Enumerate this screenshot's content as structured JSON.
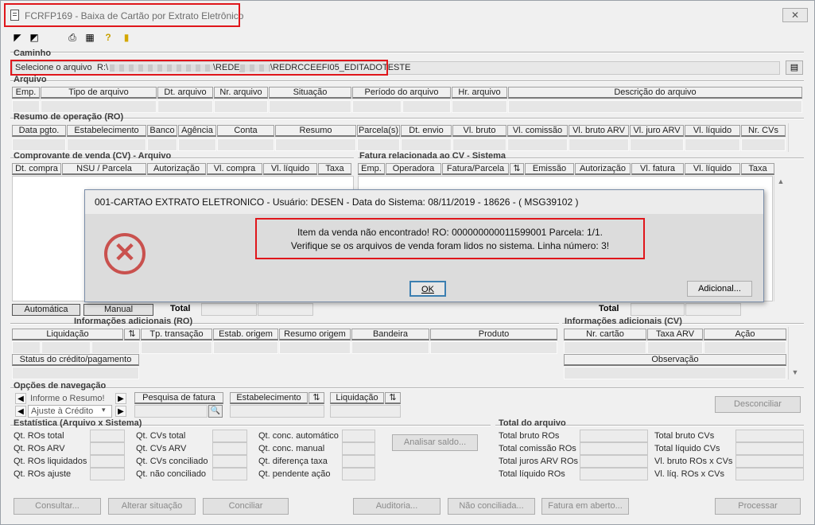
{
  "window": {
    "title": "FCRFP169 - Baixa de Cartão por Extrato Eletrônico",
    "close_label": "✕"
  },
  "toolbar": {
    "icons": [
      "first-icon",
      "exit-icon",
      "print-icon",
      "calculator-icon",
      "help-icon",
      "door-icon"
    ]
  },
  "caminho": {
    "section": "Caminho",
    "label": "Selecione o arquivo",
    "path_start": "R:\\",
    "path_mid": "\\REDE_",
    "path_end": "\\REDRCCEEFI05_EDITADOTESTE"
  },
  "arquivo": {
    "section": "Arquivo",
    "columns": [
      "Emp.",
      "Tipo de arquivo",
      "Dt. arquivo",
      "Nr. arquivo",
      "Situação",
      "Período do arquivo",
      "Hr. arquivo",
      "Descrição do arquivo"
    ]
  },
  "resumo": {
    "section": "Resumo de operação (RO)",
    "columns": [
      "Data pgto.",
      "Estabelecimento",
      "Banco",
      "Agência",
      "Conta",
      "Resumo",
      "Parcela(s)",
      "Dt. envio",
      "Vl. bruto",
      "Vl. comissão",
      "Vl. bruto ARV",
      "Vl. juro ARV",
      "Vl. líquido",
      "Nr. CVs"
    ]
  },
  "comprovante": {
    "section": "Comprovante de venda (CV) - Arquivo",
    "columns": [
      "Dt. compra",
      "NSU / Parcela",
      "Autorização",
      "Vl. compra",
      "Vl. líquido",
      "Taxa"
    ],
    "btn_automatica": "Automática",
    "btn_manual": "Manual",
    "total_label": "Total"
  },
  "fatura": {
    "section": "Fatura relacionada ao CV - Sistema",
    "columns": [
      "Emp.",
      "Operadora",
      "Fatura/Parcela",
      "",
      "Emissão",
      "Autorização",
      "Vl. fatura",
      "Vl. líquido",
      "Taxa"
    ],
    "total_label": "Total"
  },
  "dialog": {
    "title": "001-CARTAO EXTRATO ELETRONICO - Usuário: DESEN - Data do Sistema: 08/11/2019 - 18626 - ( MSG39102 )",
    "line1": "Item da venda não encontrado! RO: 000000000011599001 Parcela: 1/1.",
    "line2": "Verifique se os arquivos de venda foram lidos no sistema. Linha número: 3!",
    "ok": "OK",
    "additional": "Adicional..."
  },
  "info_ro": {
    "section": "Informações adicionais (RO)",
    "columns": [
      "Liquidação",
      "",
      "Tp. transação",
      "Estab. origem",
      "Resumo origem",
      "Bandeira",
      "Produto"
    ],
    "status_label": "Status do crédito/pagamento"
  },
  "info_cv": {
    "section": "Informações adicionais (CV)",
    "columns": [
      "Nr. cartão",
      "Taxa ARV",
      "Ação"
    ],
    "obs": "Observação"
  },
  "nav": {
    "section": "Opções de navegação",
    "informe": "Informe o Resumo!",
    "ajuste": "Ajuste à Crédito",
    "pesquisa": "Pesquisa de fatura",
    "estab": "Estabelecimento",
    "liquid": "Liquidação",
    "desconciliar": "Desconciliar"
  },
  "estat": {
    "section": "Estatística (Arquivo x Sistema)",
    "col1": [
      "Qt. ROs total",
      "Qt. ROs ARV",
      "Qt. ROs liquidados",
      "Qt. ROs ajuste"
    ],
    "col2": [
      "Qt. CVs total",
      "Qt. CVs ARV",
      "Qt. CVs conciliado",
      "Qt. não conciliado"
    ],
    "col3": [
      "Qt. conc. automático",
      "Qt. conc. manual",
      "Qt. diferença taxa",
      "Qt. pendente ação"
    ],
    "analisar": "Analisar saldo..."
  },
  "total_arq": {
    "section": "Total do arquivo",
    "col1": [
      "Total bruto ROs",
      "Total comissão ROs",
      "Total juros ARV ROs",
      "Total líquido ROs"
    ],
    "col2": [
      "Total bruto CVs",
      "Total líquido CVs",
      "Vl. bruto ROs x CVs",
      "Vl. líq. ROs x CVs"
    ]
  },
  "bottom": [
    "Consultar...",
    "Alterar situação",
    "Conciliar",
    "Auditoria...",
    "Não conciliada...",
    "Fatura em aberto...",
    "Processar"
  ]
}
